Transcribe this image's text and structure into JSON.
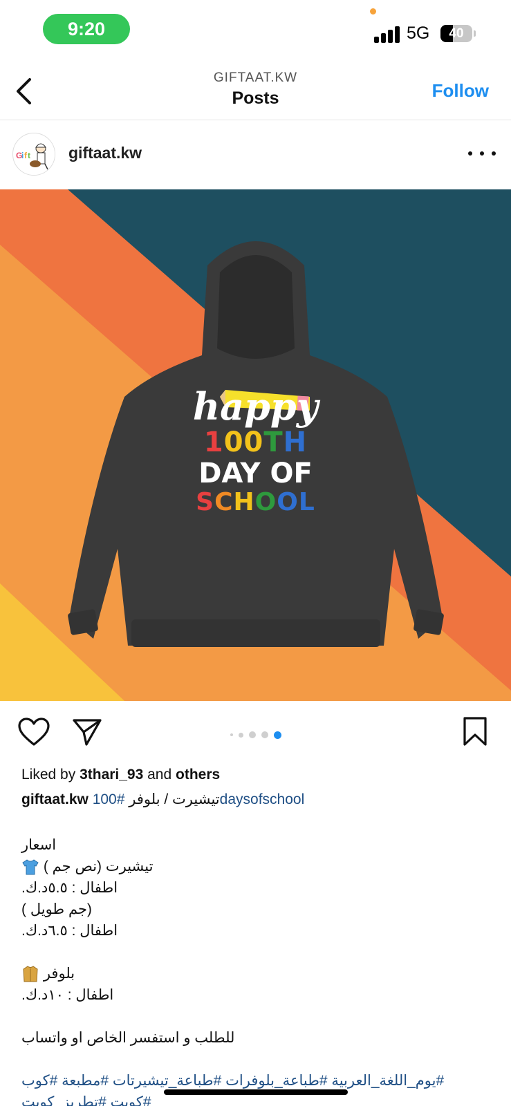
{
  "status_bar": {
    "time": "9:20",
    "network": "5G",
    "battery_percent": "40",
    "battery_level": 0.4
  },
  "nav": {
    "subtitle": "GIFTAAT.KW",
    "title": "Posts",
    "follow_label": "Follow"
  },
  "post": {
    "username": "giftaat.kw",
    "image": {
      "line1": "happy",
      "line2": "100TH",
      "line3": "DAY OF",
      "line4": "SCHOOL"
    },
    "carousel": {
      "count": 5,
      "active_index": 4
    },
    "likes": {
      "prefix": "Liked by ",
      "user": "3thari_93",
      "middle": " and ",
      "suffix": "others"
    },
    "caption": {
      "user": "giftaat.kw",
      "hashtag_num": "100#",
      "text": " تيشيرت / بلوفر",
      "hashtag_word": "daysofschool"
    },
    "body_lines": [
      "اسعار",
      "تيشيرت (نص جم )",
      "اطفال : ٥.٥د.ك.",
      "(جم طويل )",
      "اطفال : ٦.٥د.ك.",
      "",
      "بلوفر",
      "اطفال : ١٠د.ك.",
      "",
      "للطلب و استفسر الخاص او واتساب",
      ""
    ],
    "hashtags_line1": "#يوم_اللغة_العربية #طباعة_بلوفرات #طباعة_تيشيرتات #مطبعة #كوب",
    "hashtags_line2": "#كويت #تطريز_كويت"
  },
  "colors": {
    "accent": "#1d8ef0",
    "status_green": "#34c759",
    "hoodie": "#3a3a3a",
    "teal": "#1e4f60",
    "orange": "#ef7440",
    "light_orange": "#f39a45",
    "yellow": "#f8c23c"
  }
}
